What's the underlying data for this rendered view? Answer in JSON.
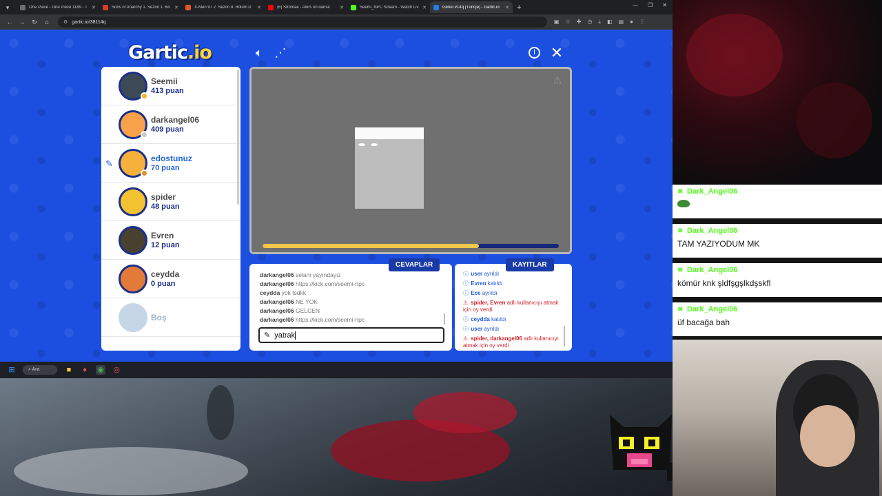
{
  "browser": {
    "tabs": [
      {
        "title": "One Piece - One Piece 1189 - T",
        "favicon_color": "#6d6d6d",
        "active": false
      },
      {
        "title": "Sons of Anarchy 1. Sezon 1. Bö",
        "favicon_color": "#d93a2b",
        "active": false
      },
      {
        "title": "X-Men 97 2. Sezon 8. Bölüm iz",
        "favicon_color": "#e8552d",
        "active": false
      },
      {
        "title": "(6) Stromae - Alors on danse",
        "favicon_color": "#ff0000",
        "active": false
      },
      {
        "title": "Seemi_NPC Stream - Watch Liv",
        "favicon_color": "#53fc18",
        "active": false
      },
      {
        "title": "Genel #14q (Türkçe) - Gartic.io",
        "favicon_color": "#2a7be4",
        "active": true
      }
    ],
    "url": "gartic.io/38114q"
  },
  "game": {
    "logo_main": "Gartic",
    "logo_suffix": ".io",
    "players": [
      {
        "name": "Seemii",
        "points": "413 puan",
        "avatar_color": "#3b4a55",
        "status_color": "#f3b61f",
        "drawing": false
      },
      {
        "name": "darkangel06",
        "points": "409 puan",
        "avatar_color": "#f7a24a",
        "status_color": "#c9c9c9",
        "drawing": false
      },
      {
        "name": "edostunuz",
        "points": "70 puan",
        "avatar_color": "#f6b03c",
        "status_color": "#e88b2e",
        "drawing": true
      },
      {
        "name": "spider",
        "points": "48 puan",
        "avatar_color": "#f2c230",
        "status_color": null,
        "drawing": false
      },
      {
        "name": "Evren",
        "points": "12 puan",
        "avatar_color": "#4a4030",
        "status_color": null,
        "drawing": false
      },
      {
        "name": "ceydda",
        "points": "0 puan",
        "avatar_color": "#e27a3a",
        "status_color": null,
        "drawing": false
      },
      {
        "name": "Boş",
        "points": "",
        "avatar_color": "#c7d6e6",
        "status_color": null,
        "drawing": false
      }
    ],
    "timer_progress": 0.73,
    "answers_tab": "CEVAPLAR",
    "log_tab": "KAYITLAR",
    "answers": [
      {
        "user": "darkangel06",
        "text": "selam yayındayız"
      },
      {
        "user": "darkangel06",
        "text": "https://kick.com/seemi-npc"
      },
      {
        "user": "ceydda",
        "text": "yok tsdkk"
      },
      {
        "user": "darkangel06",
        "text": "NE YOK"
      },
      {
        "user": "darkangel06",
        "text": "GELCEN"
      },
      {
        "user": "darkangel06",
        "text": "https://kick.com/seemi-npc"
      }
    ],
    "answer_input_value": "yatrak",
    "logs": [
      {
        "type": "info",
        "user": "user",
        "text": "ayrıldı"
      },
      {
        "type": "info",
        "user": "Evren",
        "text": "katıldı"
      },
      {
        "type": "info",
        "user": "Ece",
        "text": "ayrıldı"
      },
      {
        "type": "alert",
        "user": "spider, Evren",
        "text": "adlı kullanıcıyı atmak için oy verdi"
      },
      {
        "type": "info",
        "user": "ceydda",
        "text": "katıldı"
      },
      {
        "type": "info",
        "user": "user",
        "text": "ayrıldı"
      },
      {
        "type": "alert",
        "user": "spider, darkangel06",
        "text": "adlı kullanıcıyı atmak için oy verdi"
      }
    ]
  },
  "taskbar": {
    "search_label": "Ara"
  },
  "stream_chat": [
    {
      "user": "Dark_Angel06",
      "text": "",
      "emote": "frog"
    },
    {
      "user": "Dark_Angel06",
      "text": "TAM YAZIYODUM MK"
    },
    {
      "user": "Dark_Angel06",
      "text": "kömür knk şldfşgşlkdşskfl"
    },
    {
      "user": "Dark_Angel06",
      "text": "üf bacağa bah"
    }
  ]
}
